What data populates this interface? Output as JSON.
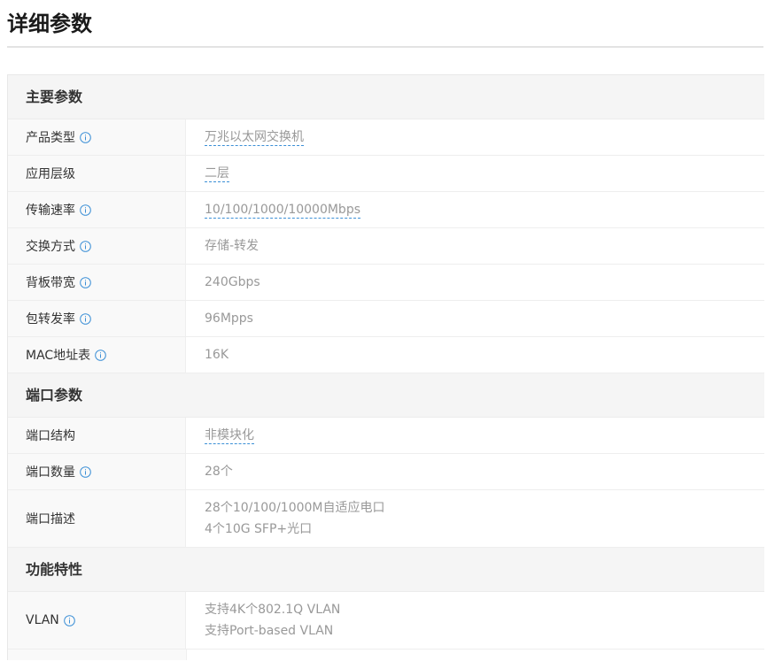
{
  "page": {
    "title": "详细参数"
  },
  "sections": [
    {
      "title": "主要参数",
      "rows": [
        {
          "label": "产品类型",
          "value": "万兆以太网交换机"
        },
        {
          "label": "应用层级",
          "value": "二层"
        },
        {
          "label": "传输速率",
          "value": "10/100/1000/10000Mbps"
        },
        {
          "label": "交换方式",
          "value": "存储-转发"
        },
        {
          "label": "背板带宽",
          "value": "240Gbps"
        },
        {
          "label": "包转发率",
          "value": "96Mpps"
        },
        {
          "label": "MAC地址表",
          "value": "16K"
        }
      ]
    },
    {
      "title": "端口参数",
      "rows": [
        {
          "label": "端口结构",
          "value": "非模块化"
        },
        {
          "label": "端口数量",
          "value": "28个"
        },
        {
          "label": "端口描述",
          "value_lines": [
            "28个10/100/1000M自适应电口",
            "4个10G SFP+光口"
          ]
        }
      ]
    },
    {
      "title": "功能特性",
      "rows": [
        {
          "label": "VLAN",
          "value_lines": [
            "支持4K个802.1Q VLAN",
            "支持Port-based VLAN"
          ]
        }
      ]
    }
  ],
  "icons": {
    "info": "info-circle-icon"
  },
  "colors": {
    "accent": "#3b8fd6",
    "value_text": "#999999",
    "label_text": "#333333"
  }
}
